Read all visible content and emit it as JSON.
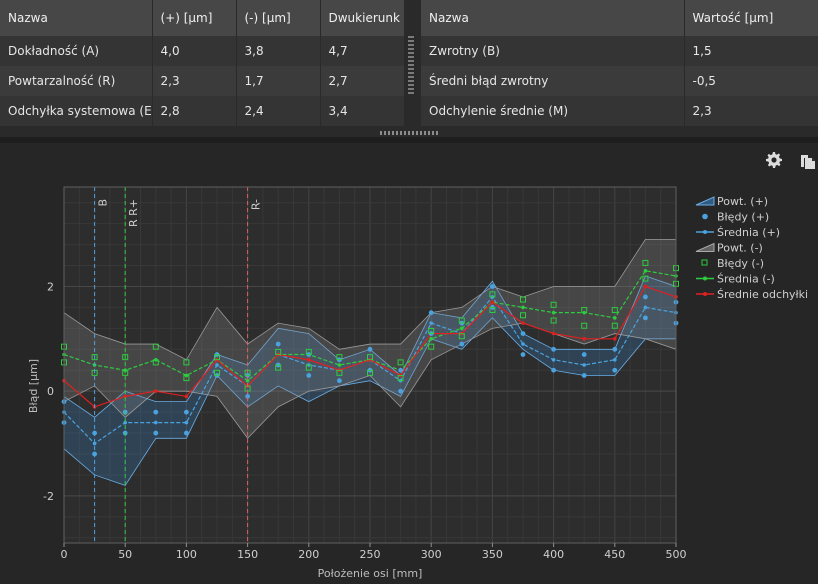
{
  "table_left": {
    "headers": [
      "Nazwa",
      "(+) [µm]",
      "(-) [µm]",
      "Dwukierunk"
    ],
    "rows": [
      [
        "Dokładność  (A)",
        "4,0",
        "3,8",
        "4,7"
      ],
      [
        "Powtarzalność (R)",
        "2,3",
        "1,7",
        "2,7"
      ],
      [
        "Odchyłka systemowa (E",
        "2,8",
        "2,4",
        "3,4"
      ]
    ]
  },
  "table_right": {
    "headers": [
      "Nazwa",
      "Wartość [µm]"
    ],
    "rows": [
      [
        "Zwrotny (B)",
        "1,5"
      ],
      [
        "Średni błąd zwrotny",
        "-0,5"
      ],
      [
        "Odchylenie średnie (M)",
        "2,3"
      ]
    ]
  },
  "toolbar": {
    "settings_icon": "gear-icon",
    "copy_icon": "copy-icon"
  },
  "chart_data": {
    "type": "line",
    "xlabel": "Położenie osi [mm]",
    "ylabel": "Błąd [µm]",
    "xlim": [
      0,
      500
    ],
    "ylim": [
      -2.9,
      3.9
    ],
    "xticks": [
      0,
      50,
      100,
      150,
      200,
      250,
      300,
      350,
      400,
      450,
      500
    ],
    "yticks": [
      -2,
      0,
      2
    ],
    "grid": true,
    "legend_position": "right",
    "markers": [
      {
        "label": "B",
        "x": 25,
        "color": "#4aa3df"
      },
      {
        "label": "R R+",
        "x": 50,
        "color": "#2ecc40"
      },
      {
        "label": "R-",
        "x": 150,
        "color": "#e06060"
      }
    ],
    "x": [
      0,
      25,
      50,
      75,
      100,
      125,
      150,
      175,
      200,
      225,
      250,
      275,
      300,
      325,
      350,
      375,
      400,
      425,
      450,
      475,
      500
    ],
    "series": [
      {
        "name": "Powt. (+)",
        "kind": "band",
        "color": "#3a7fc0",
        "upper": [
          -0.1,
          -0.5,
          0.0,
          -0.2,
          -0.2,
          0.7,
          0.5,
          1.2,
          1.1,
          0.6,
          0.8,
          0.3,
          1.5,
          1.4,
          2.1,
          1.1,
          0.8,
          0.8,
          0.8,
          2.2,
          2.0
        ],
        "lower": [
          -1.1,
          -1.6,
          -1.8,
          -0.9,
          -0.9,
          0.3,
          -0.3,
          0.1,
          -0.2,
          0.1,
          0.2,
          -0.1,
          1.0,
          0.8,
          1.4,
          0.8,
          0.4,
          0.3,
          0.3,
          1.0,
          1.0
        ]
      },
      {
        "name": "Błędy (+)",
        "kind": "points",
        "color": "#4aa3df",
        "values": [
          -0.4,
          -1.0,
          -0.6,
          -0.6,
          -0.6,
          0.5,
          0.1,
          0.7,
          0.5,
          0.4,
          0.6,
          0.2,
          1.3,
          1.1,
          1.8,
          0.9,
          0.6,
          0.5,
          0.6,
          1.6,
          1.5
        ]
      },
      {
        "name": "Średnia (+)",
        "kind": "line",
        "color": "#4aa3df",
        "values": [
          -0.4,
          -1.0,
          -0.6,
          -0.6,
          -0.6,
          0.5,
          0.1,
          0.7,
          0.5,
          0.4,
          0.6,
          0.2,
          1.3,
          1.1,
          1.8,
          0.9,
          0.6,
          0.5,
          0.6,
          1.6,
          1.5
        ]
      },
      {
        "name": "Powt. (-)",
        "kind": "band",
        "color": "#8a8a8a",
        "upper": [
          1.5,
          1.1,
          0.9,
          0.9,
          0.6,
          1.6,
          0.9,
          1.3,
          1.2,
          0.8,
          0.9,
          0.9,
          1.5,
          1.6,
          2.0,
          1.8,
          2.0,
          2.0,
          2.0,
          2.9,
          2.9
        ],
        "lower": [
          -0.2,
          0.1,
          -0.5,
          0.0,
          0.0,
          -0.1,
          -0.9,
          -0.3,
          0.0,
          0.1,
          0.3,
          -0.3,
          0.6,
          0.9,
          1.2,
          1.3,
          1.1,
          0.9,
          1.1,
          1.0,
          0.8
        ]
      },
      {
        "name": "Błędy (-)",
        "kind": "points",
        "color": "#2ecc40",
        "values": [
          0.7,
          0.5,
          0.5,
          0.7,
          0.4,
          0.5,
          0.2,
          0.6,
          0.6,
          0.5,
          0.5,
          0.4,
          1.0,
          1.2,
          1.7,
          1.6,
          1.5,
          1.4,
          1.4,
          2.3,
          2.2
        ]
      },
      {
        "name": "Średnia (-)",
        "kind": "line",
        "color": "#2ecc40",
        "values": [
          0.7,
          0.5,
          0.4,
          0.6,
          0.3,
          0.6,
          0.2,
          0.7,
          0.7,
          0.5,
          0.6,
          0.4,
          1.0,
          1.2,
          1.7,
          1.6,
          1.5,
          1.5,
          1.4,
          2.3,
          2.2
        ]
      },
      {
        "name": "Średnie odchyłki",
        "kind": "line",
        "color": "#e02020",
        "values": [
          0.2,
          -0.3,
          -0.1,
          0.0,
          -0.1,
          0.6,
          0.1,
          0.7,
          0.6,
          0.4,
          0.6,
          0.3,
          1.1,
          1.1,
          1.7,
          1.3,
          1.1,
          1.0,
          1.0,
          2.0,
          1.8
        ]
      }
    ]
  }
}
